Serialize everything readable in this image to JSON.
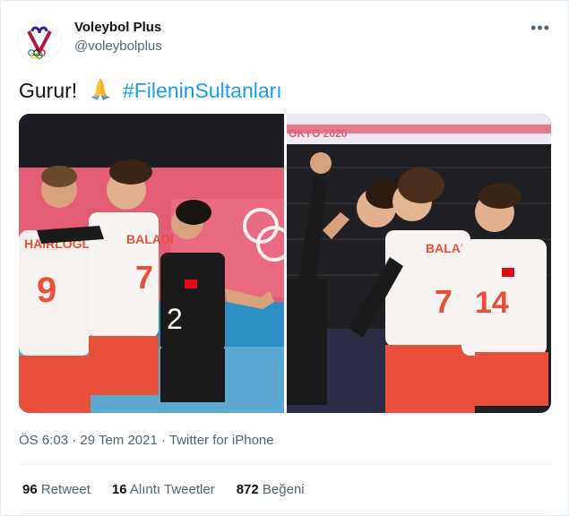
{
  "account": {
    "display_name": "Voleybol Plus",
    "handle": "@voleybolplus",
    "avatar_icon": "volleyball-heart-olympic-logo"
  },
  "menu": {
    "more_icon": "•••"
  },
  "tweet": {
    "text": "Gurur!",
    "emoji_icon": "folded-hands-emoji",
    "hashtag": "#FileninSultanları"
  },
  "photos": {
    "photo1": {
      "jersey_numbers": [
        "9",
        "7",
        "2"
      ],
      "names": [
        "HAİRLOGLU",
        "BALADİ"
      ]
    },
    "photo2": {
      "banner_text": "OKYO 2020",
      "jersey_numbers": [
        "7",
        "14"
      ],
      "names": [
        "BALADİ"
      ]
    }
  },
  "meta": {
    "timestamp": "ÖS 6:03 · 29 Tem 2021 · Twitter for iPhone"
  },
  "stats": {
    "retweets_count": "96",
    "retweets_label": "Retweet",
    "quotes_count": "16",
    "quotes_label": "Alıntı Tweetler",
    "likes_count": "872",
    "likes_label": "Beğeni"
  },
  "colors": {
    "link": "#1d9bf0",
    "jersey_red": "#e8503a",
    "secondary_text": "#536471"
  }
}
